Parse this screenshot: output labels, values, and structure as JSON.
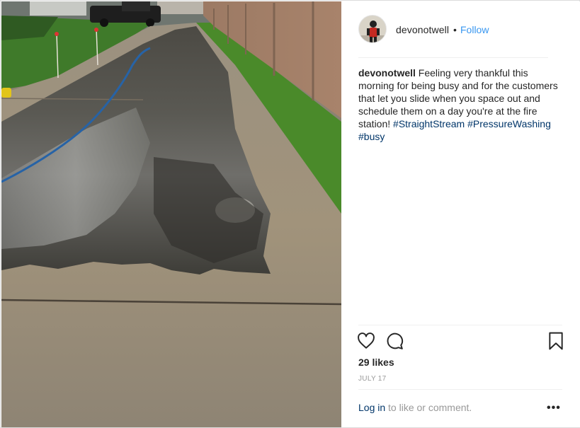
{
  "post": {
    "username": "devonotwell",
    "separator": "•",
    "follow_label": "Follow",
    "caption_text": "Feeling very thankful this morning for being busy and for the customers that let you slide when you space out and schedule them on a day you're at the fire station!",
    "hashtags": [
      "#StraightStream",
      "#PressureWashing",
      "#busy"
    ],
    "likes": "29 likes",
    "date": "JULY 17",
    "login_link": "Log in",
    "login_suffix": " to like or comment.",
    "more_label": "•••"
  },
  "icons": {
    "like": "heart-icon",
    "comment": "comment-icon",
    "save": "bookmark-icon",
    "more": "more-options-icon"
  },
  "colors": {
    "link_blue": "#3897f0",
    "hashtag": "#003569",
    "muted": "#999999",
    "text": "#262626"
  }
}
